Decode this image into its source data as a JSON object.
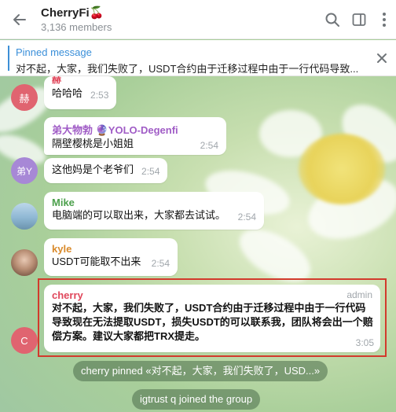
{
  "header": {
    "title": "CherryFi🍒",
    "members": "3,136 members"
  },
  "pinned": {
    "label": "Pinned message",
    "text": "对不起，大家，我们失败了，USDT合约由于迁移过程中由于一行代码导致..."
  },
  "messages": [
    {
      "sender": "赫",
      "avatar": "赫",
      "text": "哈哈哈",
      "time": "2:53",
      "sender_color": "#e0475b",
      "avatar_color": "#e06470"
    },
    {
      "sender": "弟大物勃 🔮YOLO-Degenfi",
      "text": "隔壁樱桃是小姐姐",
      "time": "2:54",
      "sender_color": "#a05cc6"
    },
    {
      "avatar": "弟Y",
      "text": "这他妈是个老爷们",
      "time": "2:54",
      "avatar_color": "#a788d6"
    },
    {
      "sender": "Mike",
      "text": "电脑端的可以取出来，大家都去试试。",
      "time": "2:54",
      "sender_color": "#4ca04c"
    },
    {
      "sender": "kyle",
      "text": "USDT可能取不出来",
      "time": "2:54",
      "sender_color": "#d98a2b"
    },
    {
      "sender": "cherry",
      "badge": "admin",
      "avatar": "C",
      "text": "对不起，大家，我们失败了，USDT合约由于迁移过程中由于一行代码导致现在无法提取USDT，损失USDT的可以联系我，团队将会出一个赔偿方案。建议大家都把TRX提走。",
      "time": "3:05",
      "sender_color": "#e0475b",
      "avatar_color": "#e06470"
    }
  ],
  "service": [
    "cherry pinned «对不起，大家，我们失败了，USD...»",
    "igtrust q joined the group"
  ],
  "colors": {
    "accent": "#3d8fd6",
    "highlight": "#d23a2c"
  },
  "icons": [
    "back-arrow-icon",
    "search-icon",
    "sidebar-toggle-icon",
    "more-vertical-icon",
    "close-icon"
  ]
}
